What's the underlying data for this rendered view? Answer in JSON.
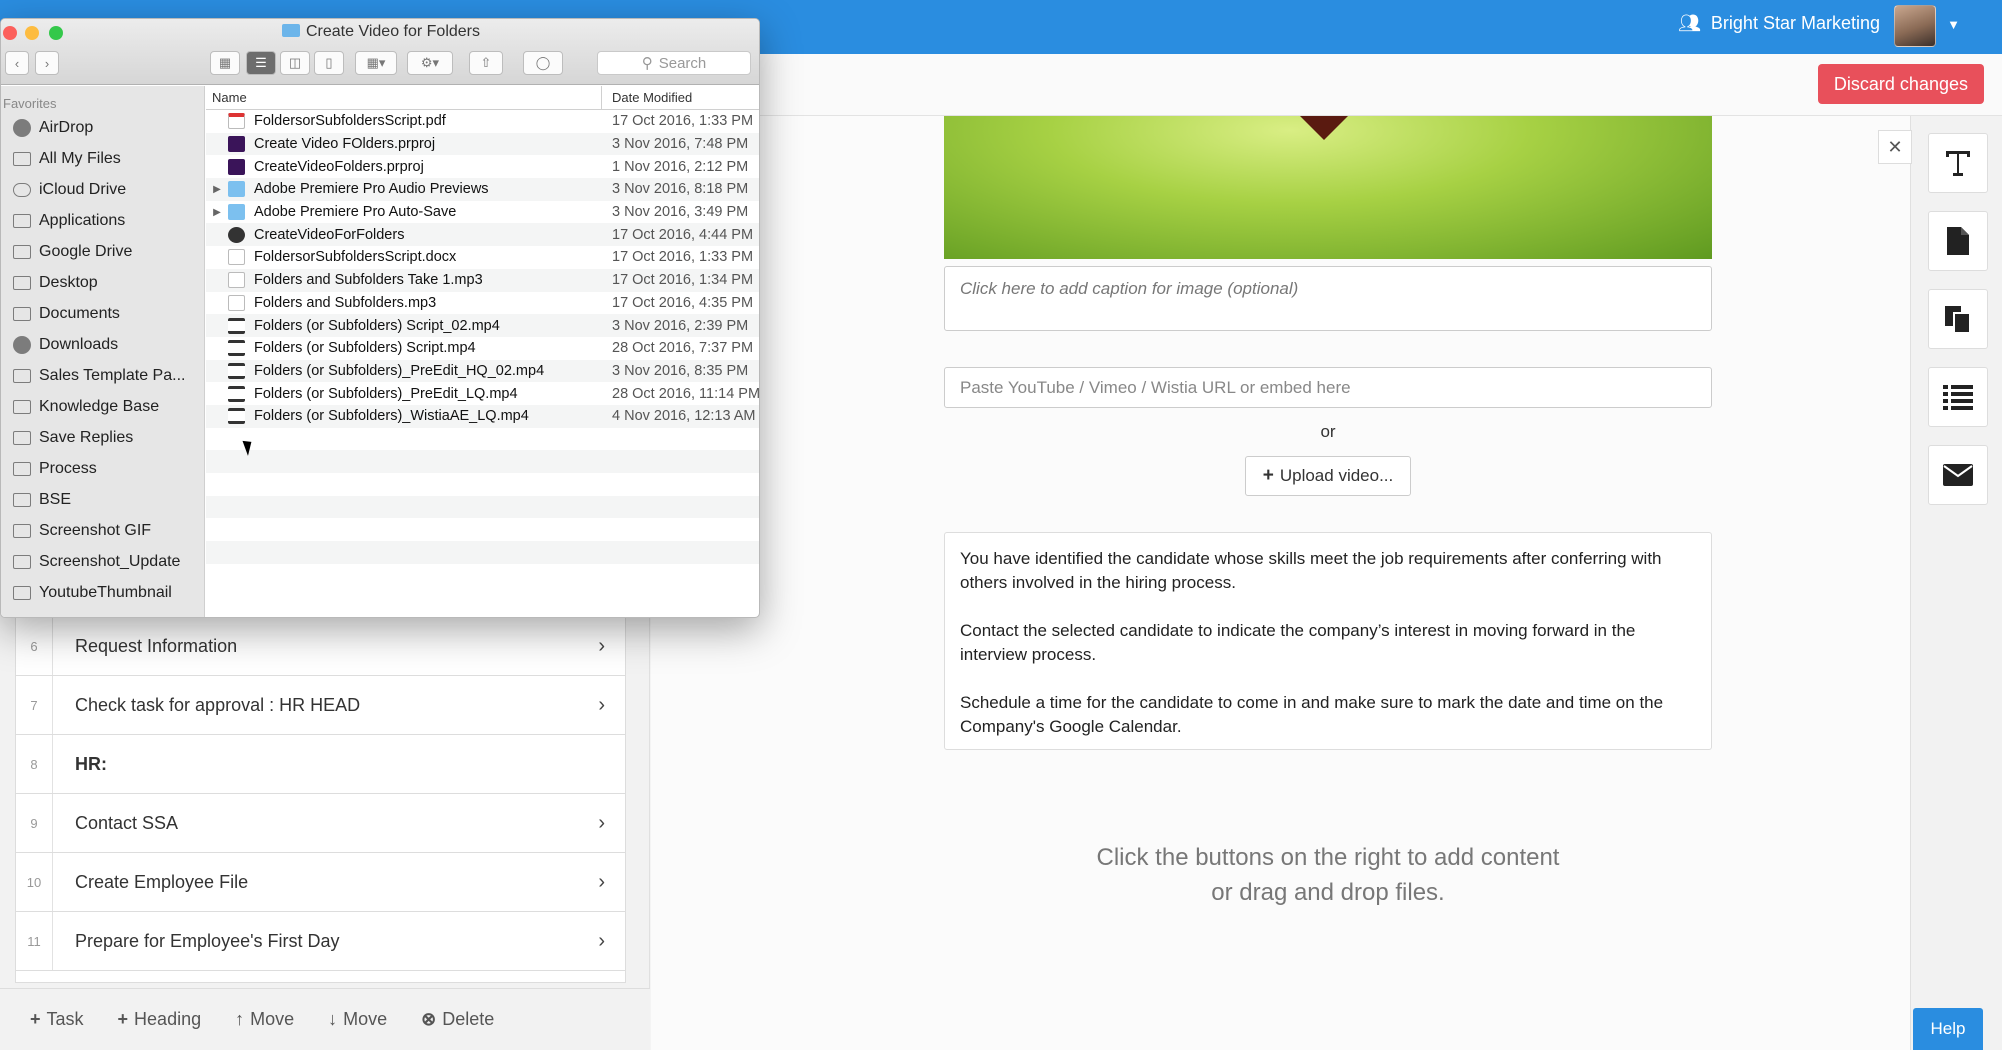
{
  "header": {
    "org_name": "Bright Star Marketing",
    "org_icon": "users-icon",
    "discard_label": "Discard changes"
  },
  "finder": {
    "title": "Create Video for Folders",
    "search_placeholder": "Search",
    "sidebar_heading": "Favorites",
    "sidebar_items": [
      {
        "label": "AirDrop",
        "icon": "airdrop-icon"
      },
      {
        "label": "All My Files",
        "icon": "files-icon"
      },
      {
        "label": "iCloud Drive",
        "icon": "cloud-icon"
      },
      {
        "label": "Applications",
        "icon": "applications-icon"
      },
      {
        "label": "Google Drive",
        "icon": "folder-icon"
      },
      {
        "label": "Desktop",
        "icon": "desktop-icon"
      },
      {
        "label": "Documents",
        "icon": "documents-icon"
      },
      {
        "label": "Downloads",
        "icon": "downloads-icon"
      },
      {
        "label": "Sales Template Pa...",
        "icon": "folder-icon"
      },
      {
        "label": "Knowledge Base",
        "icon": "folder-icon"
      },
      {
        "label": "Save Replies",
        "icon": "folder-icon"
      },
      {
        "label": "Process",
        "icon": "folder-icon"
      },
      {
        "label": "BSE",
        "icon": "folder-icon"
      },
      {
        "label": "Screenshot GIF",
        "icon": "folder-icon"
      },
      {
        "label": "Screenshot_Update",
        "icon": "folder-icon"
      },
      {
        "label": "YoutubeThumbnail",
        "icon": "folder-icon"
      }
    ],
    "columns": {
      "name": "Name",
      "date": "Date Modified"
    },
    "files": [
      {
        "name": "FoldersorSubfoldersScript.pdf",
        "date": "17 Oct 2016, 1:33 PM",
        "type": "pdf"
      },
      {
        "name": "Create Video FOlders.prproj",
        "date": "3 Nov 2016, 7:48 PM",
        "type": "prproj"
      },
      {
        "name": "CreateVideoFolders.prproj",
        "date": "1 Nov 2016, 2:12 PM",
        "type": "prproj"
      },
      {
        "name": "Adobe Premiere Pro Audio Previews",
        "date": "3 Nov 2016, 8:18 PM",
        "type": "folder"
      },
      {
        "name": "Adobe Premiere Pro Auto-Save",
        "date": "3 Nov 2016, 3:49 PM",
        "type": "folder"
      },
      {
        "name": "CreateVideoForFolders",
        "date": "17 Oct 2016, 4:44 PM",
        "type": "app"
      },
      {
        "name": "FoldersorSubfoldersScript.docx",
        "date": "17 Oct 2016, 1:33 PM",
        "type": "doc"
      },
      {
        "name": "Folders and Subfolders Take 1.mp3",
        "date": "17 Oct 2016, 1:34 PM",
        "type": "mp3"
      },
      {
        "name": "Folders and Subfolders.mp3",
        "date": "17 Oct 2016, 4:35 PM",
        "type": "mp3"
      },
      {
        "name": "Folders (or Subfolders) Script_02.mp4",
        "date": "3 Nov 2016, 2:39 PM",
        "type": "mp4"
      },
      {
        "name": "Folders (or Subfolders) Script.mp4",
        "date": "28 Oct 2016, 7:37 PM",
        "type": "mp4"
      },
      {
        "name": "Folders (or Subfolders)_PreEdit_HQ_02.mp4",
        "date": "3 Nov 2016, 8:35 PM",
        "type": "mp4"
      },
      {
        "name": "Folders (or Subfolders)_PreEdit_LQ.mp4",
        "date": "28 Oct 2016, 11:14 PM",
        "type": "mp4"
      },
      {
        "name": "Folders (or Subfolders)_WistiaAE_LQ.mp4",
        "date": "4 Nov 2016, 12:13 AM",
        "type": "mp4"
      }
    ]
  },
  "tasks": [
    {
      "num": "6",
      "label": "Request Information",
      "heading": false
    },
    {
      "num": "7",
      "label": "Check task for approval : HR HEAD",
      "heading": false
    },
    {
      "num": "8",
      "label": "HR:",
      "heading": true
    },
    {
      "num": "9",
      "label": "Contact SSA",
      "heading": false
    },
    {
      "num": "10",
      "label": "Create Employee File",
      "heading": false
    },
    {
      "num": "11",
      "label": "Prepare for Employee's First Day",
      "heading": false
    }
  ],
  "bottom_toolbar": {
    "task": "Task",
    "heading": "Heading",
    "move_up": "Move",
    "move_down": "Move",
    "delete": "Delete"
  },
  "editor": {
    "caption_placeholder": "Click here to add caption for image (optional)",
    "video_url_placeholder": "Paste YouTube / Vimeo / Wistia URL or embed here",
    "or_label": "or",
    "upload_label": "Upload video...",
    "paragraphs": [
      "You have identified the candidate whose skills meet the job requirements after conferring with others involved in the hiring process.",
      "Contact the selected candidate to indicate the company’s interest in moving forward in the interview process.",
      "Schedule a time for the candidate to come in and make sure to mark the date and time on the Company's Google Calendar."
    ],
    "hint_line1": "Click the buttons on the right to add content",
    "hint_line2": "or drag and drop files."
  },
  "right_sidebar": {
    "buttons": [
      "text-icon",
      "file-icon",
      "copy-icon",
      "list-icon",
      "email-icon"
    ],
    "close_label": "✕"
  },
  "help_label": "Help",
  "colors": {
    "brand_blue": "#2a8de0",
    "discard_red": "#e8505b"
  }
}
